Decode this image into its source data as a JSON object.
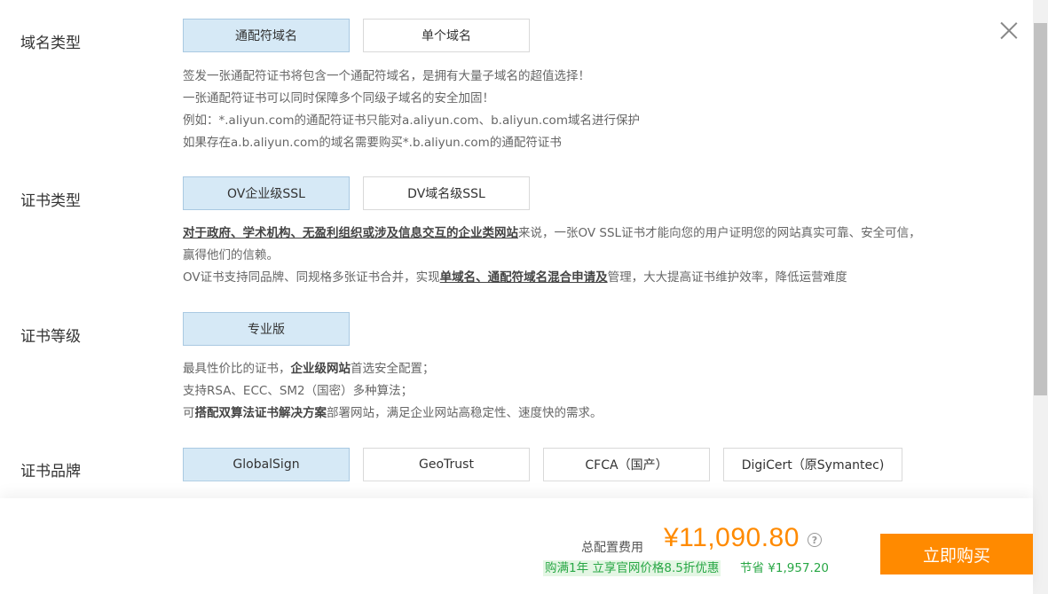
{
  "domain_type": {
    "label": "域名类型",
    "options": [
      "通配符域名",
      "单个域名"
    ],
    "selected": "通配符域名",
    "desc": [
      "签发一张通配符证书将包含一个通配符域名，是拥有大量子域名的超值选择！",
      "一张通配符证书可以同时保障多个同级子域名的安全加固！",
      "例如：*.aliyun.com的通配符证书只能对a.aliyun.com、b.aliyun.com域名进行保护",
      "如果存在a.b.aliyun.com的域名需要购买*.b.aliyun.com的通配符证书"
    ]
  },
  "cert_type": {
    "label": "证书类型",
    "options": [
      "OV企业级SSL",
      "DV域名级SSL"
    ],
    "selected": "OV企业级SSL",
    "desc_line1_bold": "对于政府、学术机构、无盈利组织或涉及信息交互的企业类网站",
    "desc_line1_rest": "来说，一张OV SSL证书才能向您的用户证明您的网站真实可靠、安全可信，",
    "desc_line2": "赢得他们的信赖。",
    "desc_line3_pre": "OV证书支持同品牌、同规格多张证书合并，实现",
    "desc_line3_bold": "单域名、通配符域名混合申请及",
    "desc_line3_post": "管理，大大提高证书维护效率，降低运营难度"
  },
  "cert_level": {
    "label": "证书等级",
    "options": [
      "专业版"
    ],
    "selected": "专业版",
    "desc_line1_pre": "最具性价比的证书，",
    "desc_line1_bold": "企业级网站",
    "desc_line1_post": "首选安全配置；",
    "desc_line2": "支持RSA、ECC、SM2（国密）多种算法；",
    "desc_line3_pre": "可",
    "desc_line3_bold": "搭配双算法证书解决方案",
    "desc_line3_post": "部署网站，满足企业网站高稳定性、速度快的需求。"
  },
  "cert_brand": {
    "label": "证书品牌",
    "options": [
      "GlobalSign",
      "GeoTrust",
      "CFCA（国产）",
      "DigiCert（原Symantec)"
    ],
    "selected": "GlobalSign"
  },
  "footer": {
    "cost_label": "总配置费用",
    "price": "¥11,090.80",
    "help": "?",
    "promo": "购满1年 立享官网价格8.5折优惠",
    "save": "节省 ¥1,957.20",
    "buy_label": "立即购买"
  },
  "colors": {
    "accent": "#ff8a00",
    "selected_bg": "#d6e9f6",
    "promo_green": "#28a745"
  }
}
